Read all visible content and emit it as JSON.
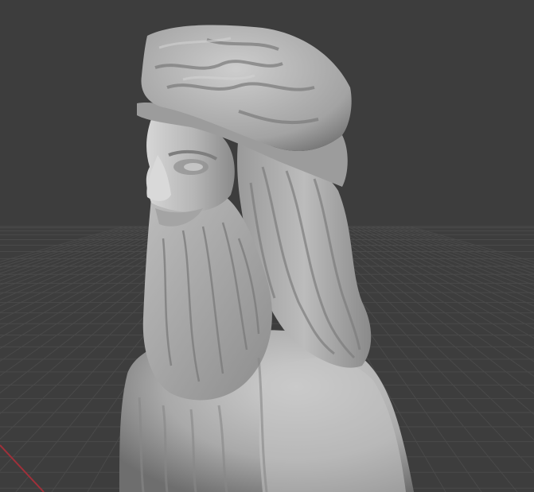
{
  "viewport": {
    "background_color": "#3d3d3d",
    "grid_color": "#4a4a4a",
    "x_axis_color": "#a0303a",
    "mesh_base_color": "#b3b3b3"
  },
  "scene": {
    "object": "bust-sculpture",
    "shading": "solid-gray"
  }
}
